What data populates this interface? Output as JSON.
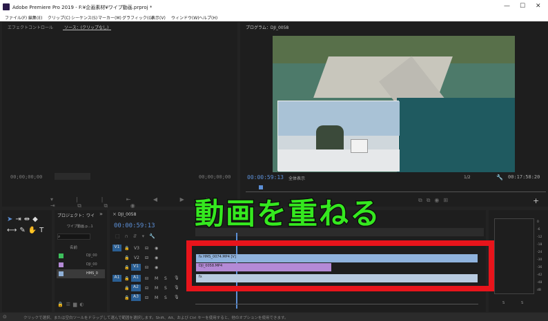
{
  "window": {
    "title": "Adobe Premiere Pro 2019 - F:¥企画素材¥ワイプ動画.prproj *",
    "minimize": "—",
    "maximize": "☐",
    "close": "✕"
  },
  "menu": [
    "ファイル(F)",
    "編集(E)",
    "クリップ(C)",
    "シーケンス(S)",
    "マーカー(M)",
    "グラフィック(G)",
    "表示(V)",
    "ウィンドウ(W)",
    "ヘルプ(H)"
  ],
  "source_panel": {
    "tabs": [
      "エフェクトコントロール",
      "ソース：(クリップなし)"
    ],
    "timecode_left": "00;00;00;00",
    "timecode_right": "00;00;00;00"
  },
  "program_panel": {
    "tab": "プログラム：DJI_0058",
    "timecode": "00:00:59:13",
    "fit": "全体表示",
    "resolution": "1/2",
    "duration": "00:17:58:20"
  },
  "project_panel": {
    "tab": "プロジェクト：ワイ",
    "project_name": "ワイプ動画.p...1",
    "name_header": "名前",
    "items": [
      {
        "name": "DJI_00",
        "color": "#3dbf5c"
      },
      {
        "name": "DJI_00",
        "color": "#b48ad6"
      },
      {
        "name": "HMS_0",
        "color": "#8fb0d8"
      }
    ]
  },
  "timeline": {
    "tab": "DJI_0058",
    "timecode": "00:00:59:13",
    "video_tracks": [
      {
        "label": "V3"
      },
      {
        "label": "V2"
      },
      {
        "label": "V1"
      }
    ],
    "audio_tracks": [
      {
        "label": "A1"
      },
      {
        "label": "A2"
      },
      {
        "label": "A3"
      }
    ],
    "src_v": "V1",
    "src_a": "A1",
    "clips": {
      "v2": "fx HMS_0074.MP4 [V]",
      "v1": "DJI_0058.MP4",
      "a1": "fx"
    },
    "m": "M",
    "s": "S"
  },
  "meter_labels": [
    "0",
    "-6",
    "-12",
    "-18",
    "-24",
    "-30",
    "-36",
    "-42",
    "-48",
    "dB"
  ],
  "meter_bottom": [
    "S",
    "S"
  ],
  "overlay_text": "動画を重ねる",
  "status": "クリックで選択、または空白ツールをドラッグして選んで範囲を選択します。Shift、Alt、および Ctrl キーを使用すると、他のオプションを使用できます。",
  "colors": {
    "accent": "#5c8fd6",
    "clip_blue": "#8fb3dd",
    "clip_purple": "#b48ad6",
    "overlay_green": "#35e81f",
    "red_box": "#e8141b"
  }
}
